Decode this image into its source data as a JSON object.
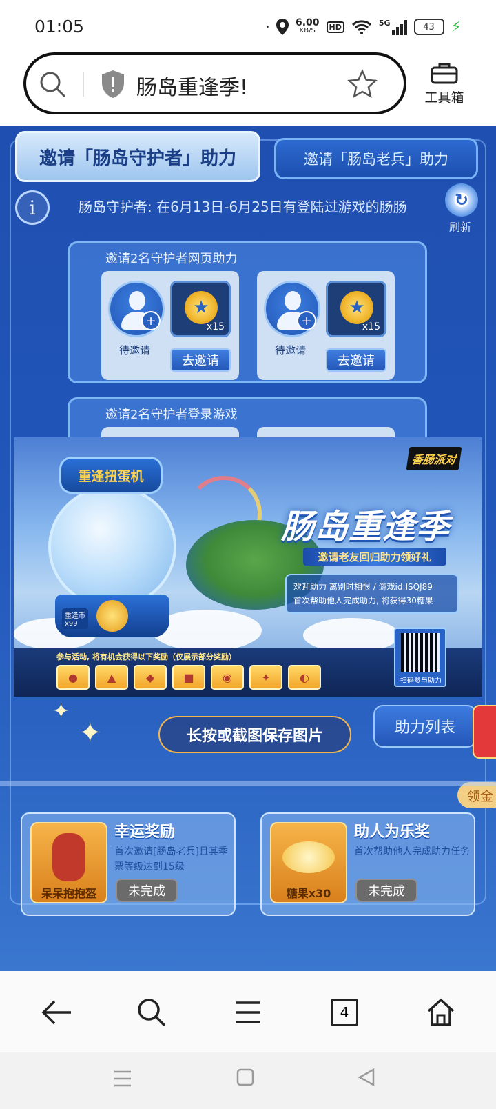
{
  "status_bar": {
    "time": "01:05",
    "speed": "6.00",
    "speed_unit": "KB/S",
    "hd": "HD",
    "network": "5G",
    "battery": "43"
  },
  "browser": {
    "url_text": "肠岛重逢季!",
    "tools_label": "工具箱"
  },
  "tabs": [
    {
      "label": "邀请「肠岛守护者」助力"
    },
    {
      "label": "邀请「肠岛老兵」助力"
    }
  ],
  "info": {
    "text": "肠岛守护者: 在6月13日-6月25日有登陆过游戏的肠肠",
    "refresh_label": "刷新"
  },
  "panels": [
    {
      "title": "邀请2名守护者网页助力",
      "slots": [
        {
          "status": "待邀请",
          "reward_qty": "x15",
          "button": "去邀请"
        },
        {
          "status": "待邀请",
          "reward_qty": "x15",
          "button": "去邀请"
        }
      ]
    },
    {
      "title": "邀请2名守护者登录游戏"
    }
  ],
  "poster": {
    "logo": "香肠派对",
    "machine_label": "重逢扭蛋机",
    "machine_currency": "重逢币",
    "machine_count": "x99",
    "title": "肠岛重逢季",
    "subtitle": "邀请老友回归助力领好礼",
    "info_line1": "欢迎助力 离别时相恨 / 游戏id:ISQJ89",
    "info_line2": "首次帮助他人完成助力, 将获得30糖果",
    "rewards_caption": "参与活动, 将有机会获得以下奖励（仅展示部分奖励）",
    "qr_label": "扫码参与助力"
  },
  "save_hint": "长按或截图保存图片",
  "help_list_label": "助力列表",
  "gold_tab_label": "领金",
  "cards": [
    {
      "title": "幸运奖励",
      "desc": "首次邀请[肠岛老兵]且其季票等级达到15级",
      "image_label": "呆呆抱抱盔",
      "button": "未完成"
    },
    {
      "title": "助人为乐奖",
      "desc": "首次帮助他人完成助力任务",
      "image_label": "糖果x30",
      "button": "未完成"
    }
  ],
  "bottom_nav": {
    "tab_count": "4"
  }
}
